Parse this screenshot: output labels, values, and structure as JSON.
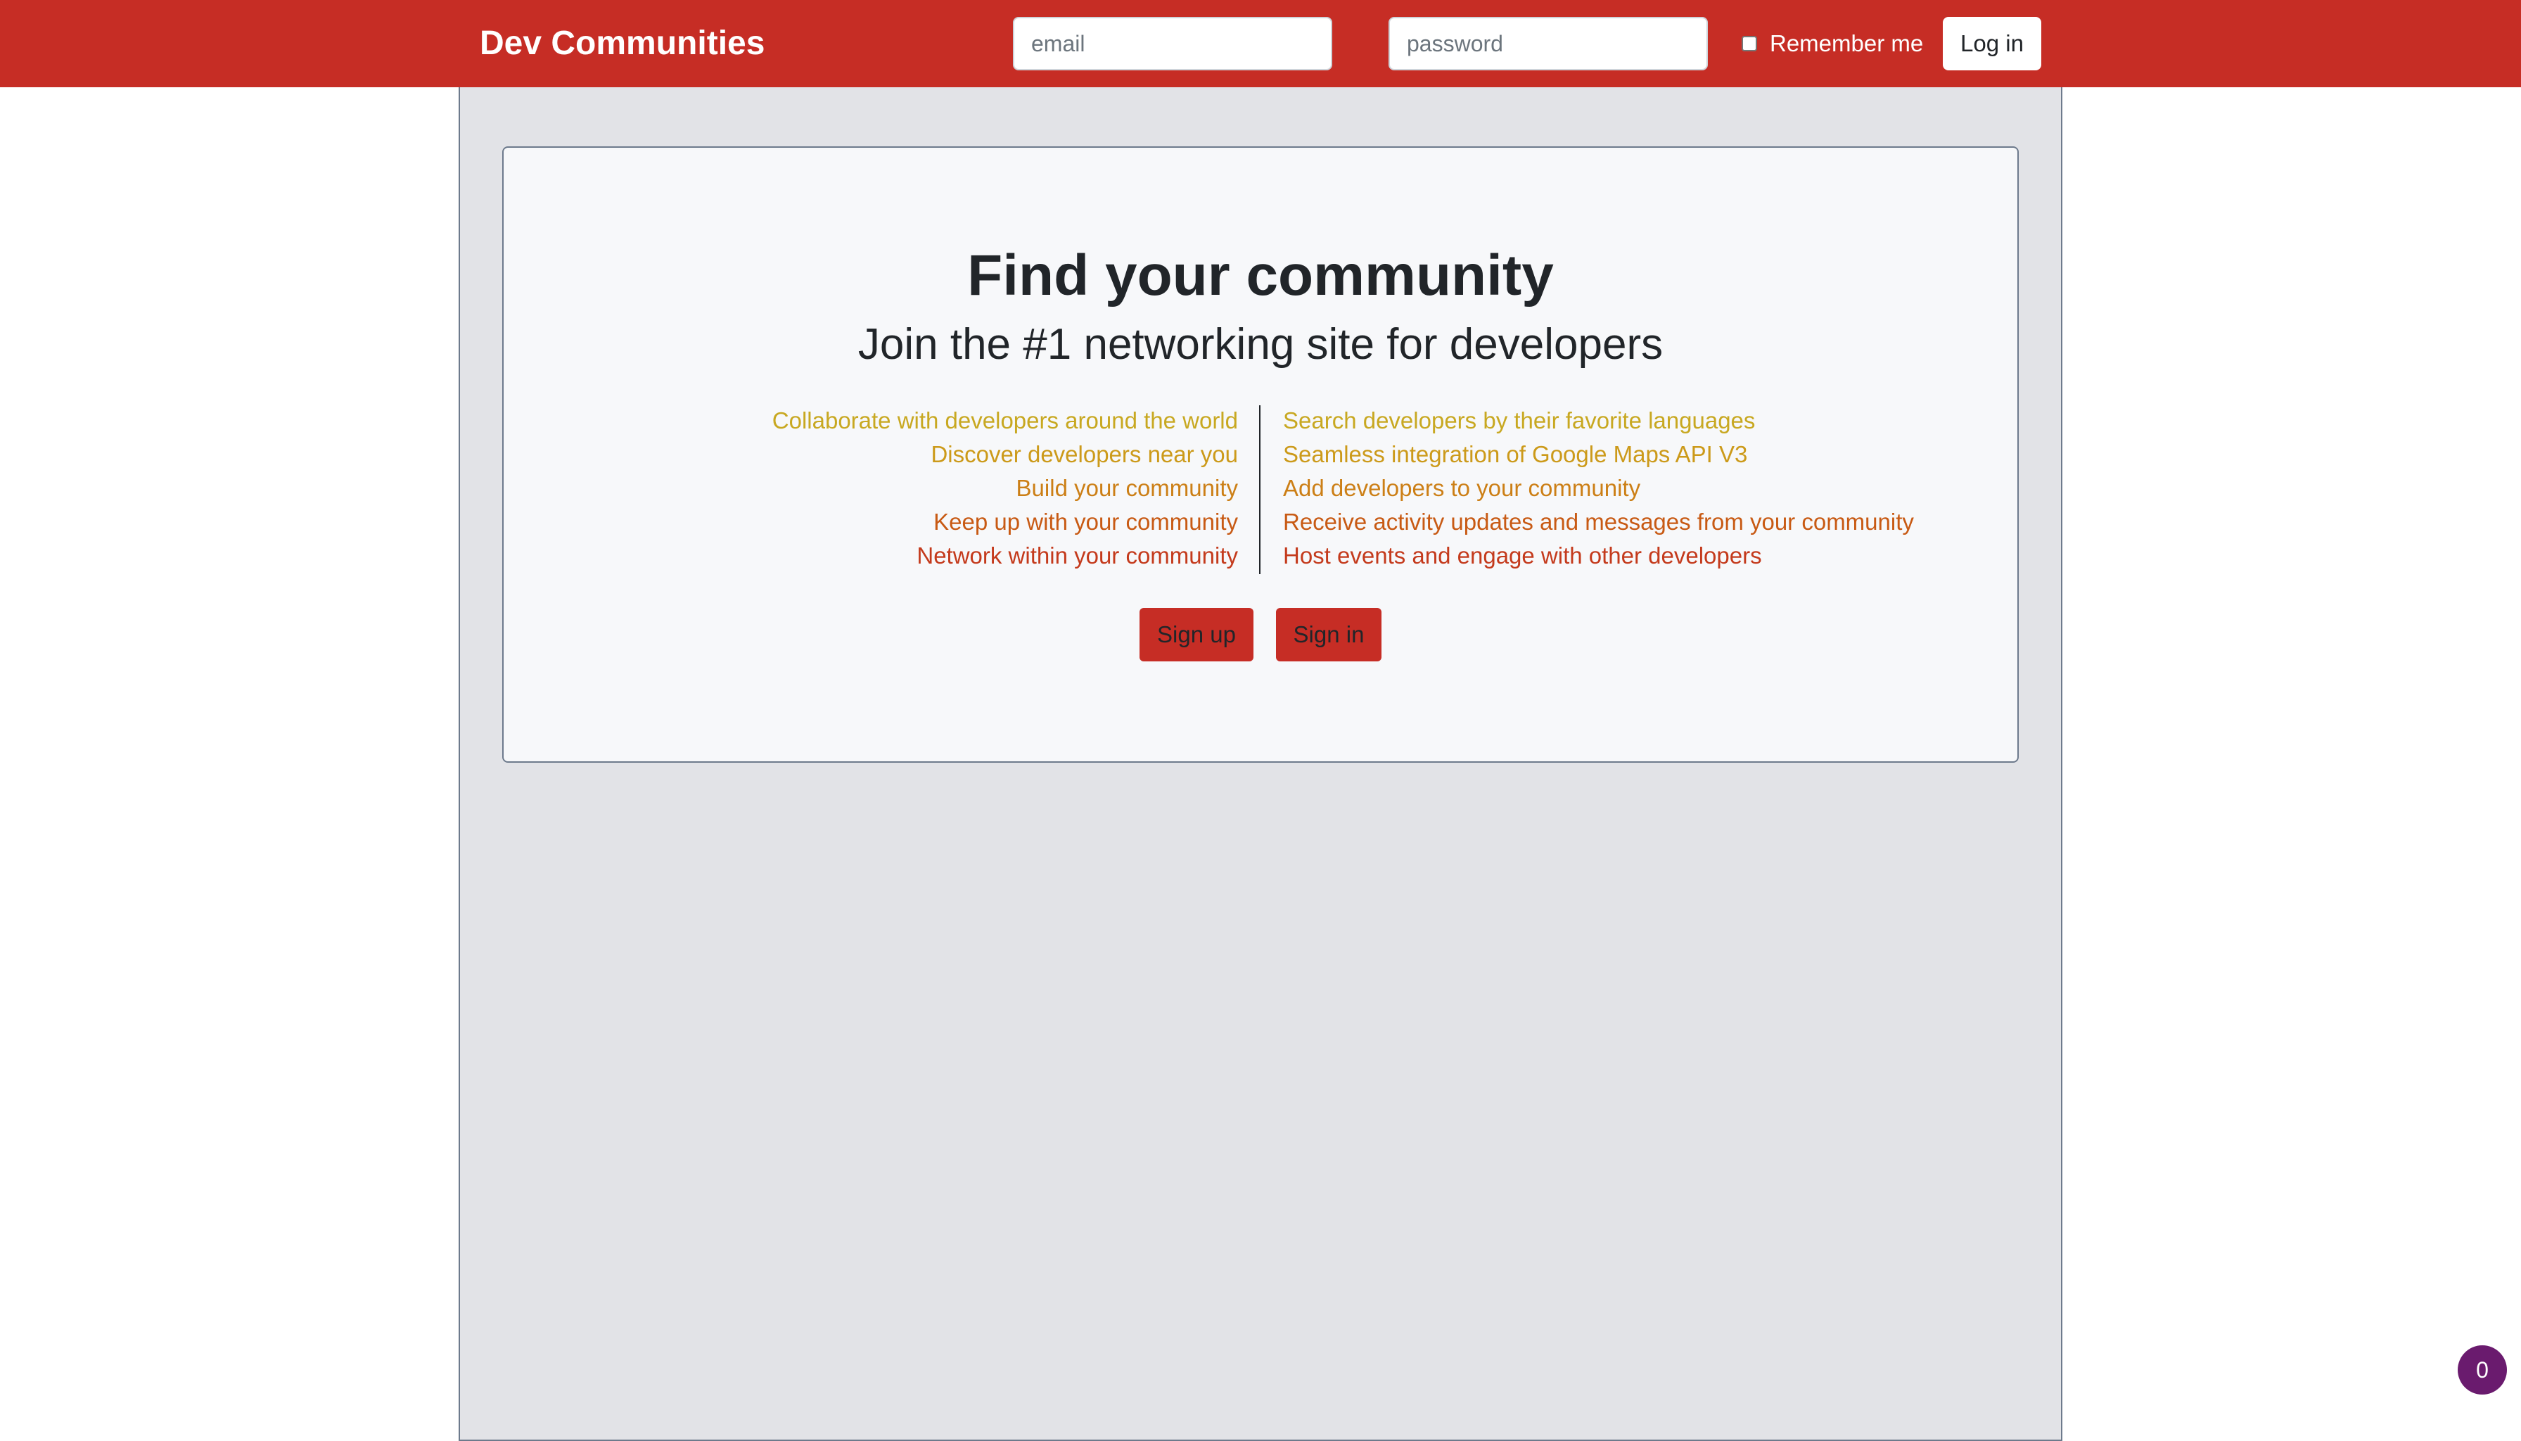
{
  "navbar": {
    "brand": "Dev Communities",
    "email_placeholder": "email",
    "password_placeholder": "password",
    "remember_label": "Remember me",
    "login_label": "Log in",
    "background_color": "#c62d25"
  },
  "hero": {
    "title": "Find your community",
    "subtitle": "Join the #1 networking site for developers",
    "features_left": [
      {
        "text": "Collaborate with developers around the world",
        "color": "#c8a821"
      },
      {
        "text": "Discover developers near you",
        "color": "#cc9a1a"
      },
      {
        "text": "Build your community",
        "color": "#cc7f16"
      },
      {
        "text": "Keep up with your community",
        "color": "#c85a14"
      },
      {
        "text": "Network within your community",
        "color": "#c43a1c"
      }
    ],
    "features_right": [
      {
        "text": "Search developers by their favorite languages",
        "color": "#c8a821"
      },
      {
        "text": "Seamless integration of Google Maps API V3",
        "color": "#cc9a1a"
      },
      {
        "text": "Add developers to your community",
        "color": "#cc7f16"
      },
      {
        "text": "Receive activity updates and messages from your community",
        "color": "#c85a14"
      },
      {
        "text": "Host events and engage with other developers",
        "color": "#c43a1c"
      }
    ],
    "signup_label": "Sign up",
    "signin_label": "Sign in"
  },
  "notification_badge": {
    "count": "0",
    "color": "#6a1b6e"
  }
}
